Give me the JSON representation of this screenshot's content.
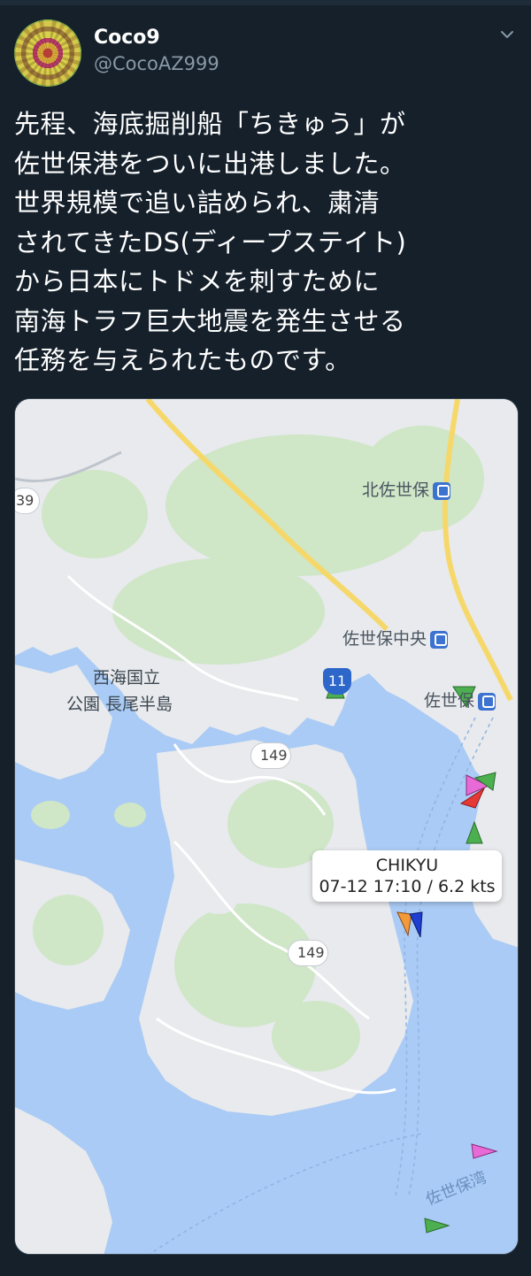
{
  "tweet": {
    "display_name": "Coco9",
    "handle": "@CocoAZ999",
    "text": "先程、海底掘削船「ちきゅう」が\n佐世保港をついに出港しました。\n世界規模で追い詰められ、粛清\nされてきたDS(ディープステイト)\nから日本にトドメを刺すために\n南海トラフ巨大地震を発生させる\n任務を与えられたものです。"
  },
  "icons": {
    "menu": "chevron-down-icon",
    "station": "train-station-icon"
  },
  "map": {
    "labels": {
      "kita_sasebo": "北佐世保",
      "sasebo_chuo": "佐世保中央",
      "sasebo": "佐世保",
      "park_line1": "西海国立",
      "park_line2": "公園 長尾半島",
      "bay": "佐世保湾",
      "route_edge": "39"
    },
    "routes": {
      "r11": "11",
      "r149_upper": "149",
      "r149_lower": "149"
    },
    "vessel": {
      "name": "CHIKYU",
      "info": "07-12 17:10 / 6.2 kts"
    },
    "colors": {
      "water": "#aacbf5",
      "land": "#e8eaed",
      "forest": "#cfe6c7",
      "road": "#ffffff",
      "highway": "#f6d86a"
    }
  }
}
